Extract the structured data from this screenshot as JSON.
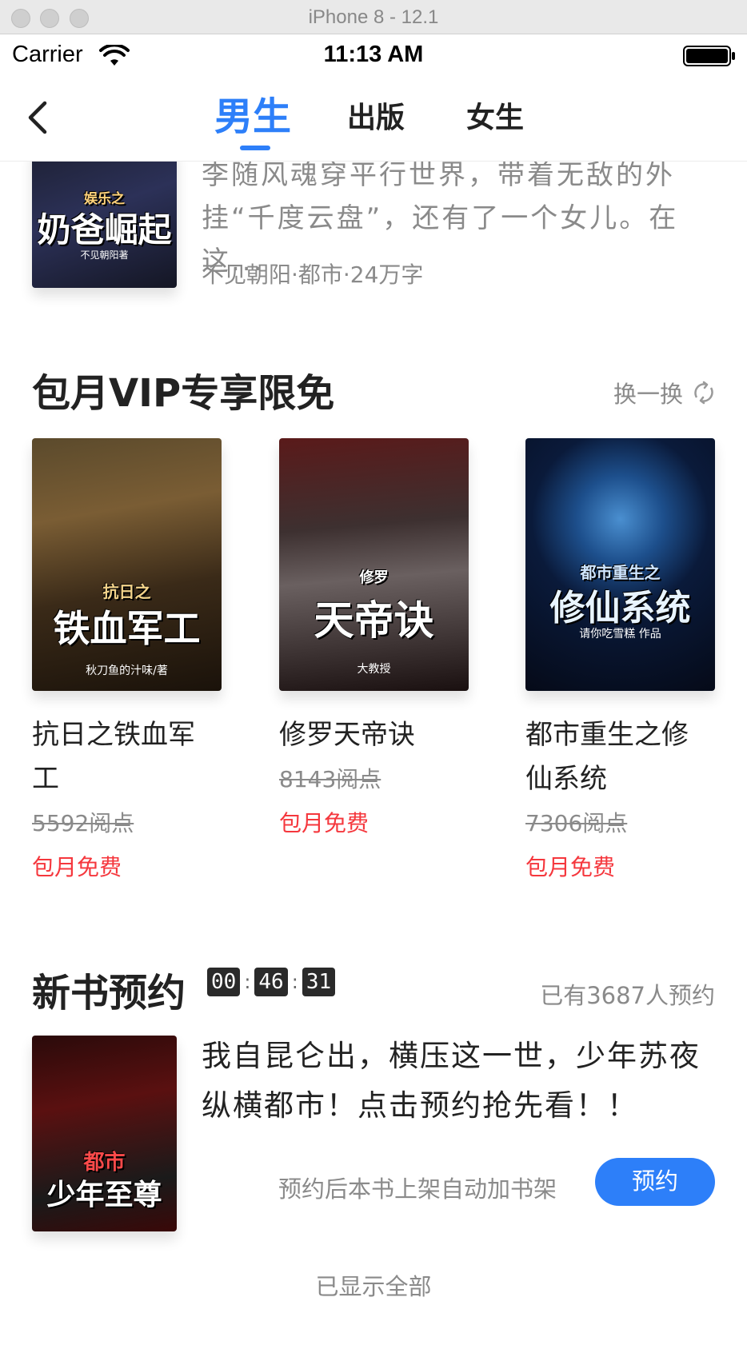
{
  "simulator": {
    "title": "iPhone 8 - 12.1"
  },
  "status_bar": {
    "carrier": "Carrier",
    "time": "11:13 AM"
  },
  "nav": {
    "tabs": [
      {
        "label": "男生",
        "active": true
      },
      {
        "label": "出版",
        "active": false
      },
      {
        "label": "女生",
        "active": false
      }
    ],
    "accent_color": "#2d7ff9"
  },
  "top_book": {
    "cover_title": "奶爸崛起",
    "cover_subtitle": "娱乐之",
    "cover_author": "不见朝阳著",
    "description": "李随风魂穿平行世界，带着无敌的外挂“千度云盘”，还有了一个女儿。在这...",
    "meta": "不见朝阳·都市·24万字"
  },
  "vip_section": {
    "title": "包月VIP专享限免",
    "refresh_label": "换一换",
    "books": [
      {
        "cover_title": "铁血军工",
        "cover_subtitle": "抗日之",
        "cover_author": "秋刀鱼的汁味/著",
        "name": "抗日之铁血军工",
        "old_price": "5592阅点",
        "free_label": "包月免费"
      },
      {
        "cover_title": "天帝诀",
        "cover_subtitle": "修罗",
        "cover_author": "大教授",
        "name": "修罗天帝诀",
        "old_price": "8143阅点",
        "free_label": "包月免费"
      },
      {
        "cover_title": "修仙系统",
        "cover_subtitle": "都市重生之",
        "cover_author": "请你吃雪糕 作品",
        "name": "都市重生之修仙系统",
        "old_price": "7306阅点",
        "free_label": "包月免费"
      }
    ]
  },
  "new_book_section": {
    "title": "新书预约",
    "timer": [
      "00",
      "46",
      "31"
    ],
    "reserve_count": "已有3687人预约",
    "cover_title": "少年至尊",
    "cover_subtitle": "都市",
    "description": "我自昆仑出，横压这一世，少年苏夜纵横都市！点击预约抢先看！！",
    "hint": "预约后本书上架自动加书架",
    "reserve_button": "预约"
  },
  "footer": {
    "note": "已显示全部"
  },
  "colors": {
    "price_red": "#f5373d",
    "muted_gray": "#8a8a8a"
  }
}
